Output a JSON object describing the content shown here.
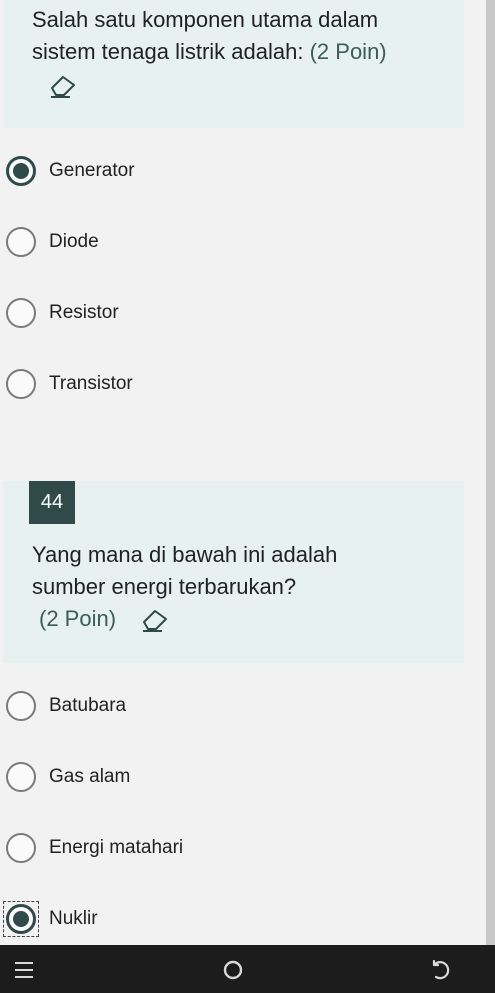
{
  "question1": {
    "text": "Salah satu komponen utama dalam sistem tenaga listrik adalah:",
    "points": "(2 Poin)",
    "options": [
      {
        "label": "Generator",
        "selected": true
      },
      {
        "label": "Diode",
        "selected": false
      },
      {
        "label": "Resistor",
        "selected": false
      },
      {
        "label": "Transistor",
        "selected": false
      }
    ]
  },
  "question2": {
    "number": "44",
    "text_line1": "Yang mana di bawah ini adalah",
    "text_line2": "sumber energi terbarukan?",
    "points": "(2 Poin)",
    "options": [
      {
        "label": "Batubara",
        "selected": false
      },
      {
        "label": "Gas alam",
        "selected": false
      },
      {
        "label": "Energi matahari",
        "selected": false
      },
      {
        "label": "Nuklir",
        "selected": true
      }
    ]
  },
  "icons": {
    "eraser": "eraser-icon",
    "nav_menu": "recent-apps-icon",
    "nav_home": "home-icon",
    "nav_back": "back-icon"
  },
  "colors": {
    "accent": "#2f4a49",
    "question_bg": "#e6f1f0",
    "page_bg": "#f2f2f2",
    "navbar_bg": "#1c1c1c"
  }
}
